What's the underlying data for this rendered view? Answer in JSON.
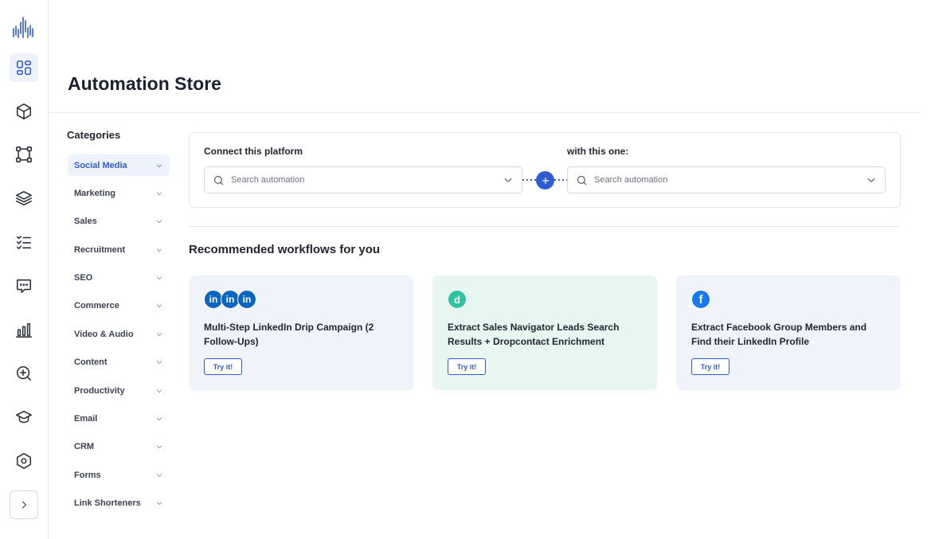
{
  "colors": {
    "accent": "#2f5bd3",
    "card_blue": "#f0f4fa",
    "card_green": "#e8f6f1"
  },
  "rail": {
    "icons": [
      "dashboard-icon",
      "cube-icon",
      "vector-icon",
      "layers-icon",
      "checklist-icon",
      "chat-icon",
      "bar-chart-icon",
      "zoom-in-icon",
      "graduation-cap-icon",
      "hexagon-settings-icon"
    ],
    "expand_icon": "chevron-right-icon"
  },
  "header": {
    "title": "Automation Store"
  },
  "categories": {
    "heading": "Categories",
    "items": [
      "Social Media",
      "Marketing",
      "Sales",
      "Recruitment",
      "SEO",
      "Commerce",
      "Video & Audio",
      "Content",
      "Productivity",
      "Email",
      "CRM",
      "Forms",
      "Link Shorteners"
    ],
    "active": "Social Media"
  },
  "connect": {
    "left_label": "Connect this platform",
    "right_label": "with this one:",
    "left_placeholder": "Search automation",
    "right_placeholder": "Search automation"
  },
  "recommended": {
    "title": "Recommended workflows for you",
    "cards": [
      {
        "title": "Multi-Step LinkedIn Drip Campaign (2 Follow-Ups)",
        "logos": [
          "in",
          "in",
          "in"
        ],
        "button": "Try it!"
      },
      {
        "title": "Extract Sales Navigator Leads Search Results + Dropcontact Enrichment",
        "logos": [
          "d"
        ],
        "button": "Try it!"
      },
      {
        "title": "Extract Facebook Group Members and Find their LinkedIn Profile",
        "logos": [
          "f"
        ],
        "button": "Try it!"
      }
    ]
  }
}
